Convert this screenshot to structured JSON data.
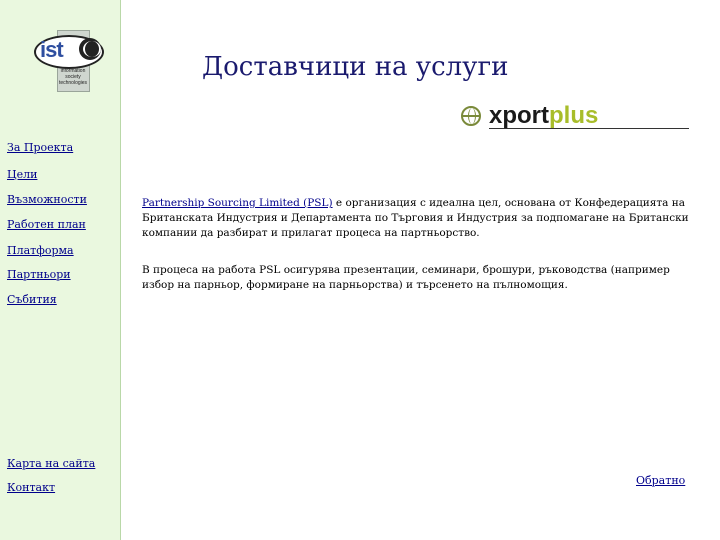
{
  "logo": {
    "main_text": "ist",
    "caption": [
      "information",
      "society",
      "technologies"
    ]
  },
  "nav": {
    "items": [
      {
        "label": "За Проекта"
      },
      {
        "label": "Цели"
      },
      {
        "label": "Възможности"
      },
      {
        "label": "Работен план"
      },
      {
        "label": "Платформа"
      },
      {
        "label": "Партньори"
      },
      {
        "label": "Събития"
      }
    ],
    "bottom_items": [
      {
        "label": "Карта на сайта"
      },
      {
        "label": "Контакт"
      }
    ]
  },
  "header": {
    "title": "Доставчици на услуги"
  },
  "partner_logo": {
    "text_dark": "xport",
    "text_accent": "plus",
    "colors": {
      "dark": "#1a1a1a",
      "accent": "#a8bd2a"
    }
  },
  "content": {
    "paragraph1": {
      "link_text": "Partnership Sourcing Limited (PSL)",
      "text": " е организация с идеална цел, основана от Конфедерацията на Британската Индустрия и Департамента по Търговия и Индустрия за подпомагане на Британски компании да разбират и прилагат процеса на партньорство."
    },
    "paragraph2": {
      "text": "В процеса на работа PSL осигурява презентации, семинари, брошури, ръководства (например избор на парньор, формиране на парньорства) и търсенето на пълномощия."
    }
  },
  "footer": {
    "back_label": "Обратно"
  },
  "colors": {
    "sidebar_bg": "#eaf8df",
    "link": "#00008b",
    "title": "#1a1a6e"
  }
}
